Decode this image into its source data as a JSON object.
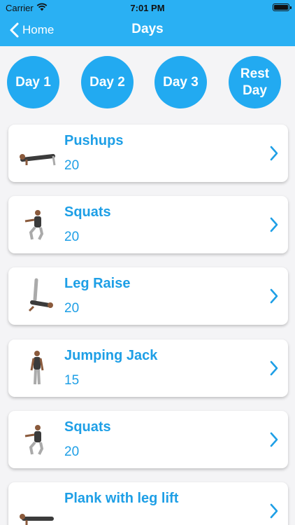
{
  "status_bar": {
    "carrier": "Carrier",
    "time": "7:01 PM"
  },
  "nav": {
    "back_label": "Home",
    "title": "Days"
  },
  "days": [
    "Day 1",
    "Day 2",
    "Day 3",
    "Rest Day"
  ],
  "exercises": [
    {
      "name": "Pushups",
      "reps": "20",
      "icon": "pushup-figure-icon"
    },
    {
      "name": "Squats",
      "reps": "20",
      "icon": "squat-figure-icon"
    },
    {
      "name": "Leg Raise",
      "reps": "20",
      "icon": "leg-raise-figure-icon"
    },
    {
      "name": "Jumping Jack",
      "reps": "15",
      "icon": "jumping-jack-figure-icon"
    },
    {
      "name": "Squats",
      "reps": "20",
      "icon": "squat-figure-icon"
    },
    {
      "name": "Plank with leg lift",
      "reps": "",
      "icon": "plank-figure-icon"
    }
  ],
  "colors": {
    "header": "#2ab0f3",
    "accent": "#1e9fe6",
    "background": "#f4f4f6"
  }
}
